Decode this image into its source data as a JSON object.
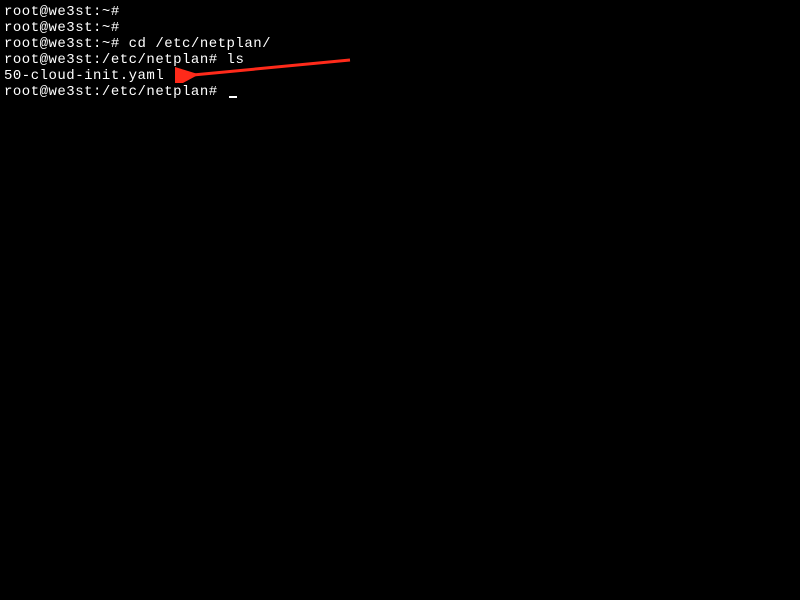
{
  "lines": [
    {
      "prompt": "root@we3st:~#",
      "command": ""
    },
    {
      "prompt": "root@we3st:~#",
      "command": ""
    },
    {
      "prompt": "root@we3st:~#",
      "command": " cd /etc/netplan/"
    },
    {
      "prompt": "root@we3st:/etc/netplan#",
      "command": " ls"
    },
    {
      "output": "50-cloud-init.yaml"
    },
    {
      "prompt": "root@we3st:/etc/netplan#",
      "command": " ",
      "cursor": true
    }
  ],
  "annotation": {
    "color": "#ff2a1a"
  }
}
